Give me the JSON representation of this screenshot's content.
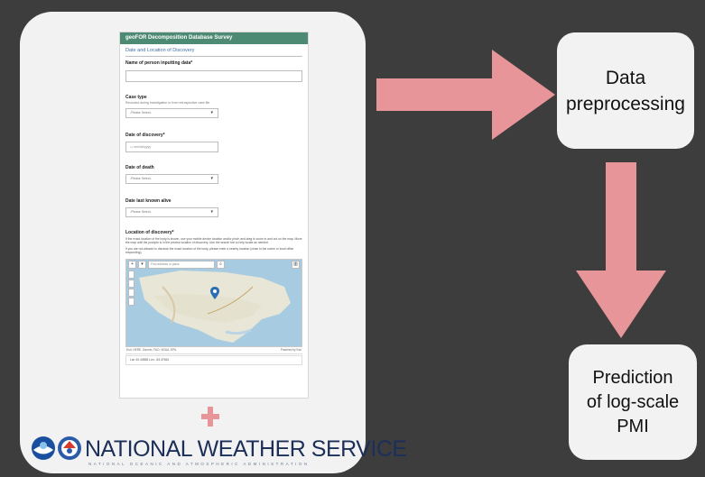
{
  "form": {
    "header": "geoFOR Decomposition Database Survey",
    "section_title": "Date and Location of Discovery",
    "name_label": "Name of person inputting data*",
    "case_type_label": "Case type",
    "case_type_help": "Recorded during investigation or from retrospective case file",
    "select_placeholder": "-Please Select-",
    "date_discovery_label": "Date of discovery*",
    "date_placeholder": "mm/dd/yyyy",
    "date_death_label": "Date of death",
    "date_alive_label": "Date last known alive",
    "location_label": "Location of discovery*",
    "location_help_1": "If the exact location of the body is known, use your mobile device location and/or pinch and drag to zoom in and out on the map. Move the map until the pushpin is in the precise location of discovery. Use the search bar to help locate as needed.",
    "location_help_2": "If you are not allowed to disclose the exact location of the body, please enter a nearby location (close to the scene or local office responding).",
    "map_search_placeholder": "Find address or place",
    "map_attribution_left": "Esri, HERE, Garmin, FAO, NOAA, EPA",
    "map_attribution_right": "Powered by Esri",
    "coordinates": "Lat: 40.40858  Lon: -84.37661"
  },
  "nws": {
    "title": "NATIONAL WEATHER SERVICE",
    "subtitle": "NATIONAL OCEANIC AND ATMOSPHERIC ADMINISTRATION"
  },
  "boxes": {
    "preprocessing": [
      "Data",
      "preprocessing"
    ],
    "prediction": [
      "Prediction",
      "of log-scale",
      "PMI"
    ]
  },
  "colors": {
    "background": "#3d3d3d",
    "panel": "#f2f2f2",
    "arrow": "#e8959a",
    "plus": "#e8959a",
    "form_header": "#4d8a74",
    "nws_text": "#1c2f59"
  }
}
